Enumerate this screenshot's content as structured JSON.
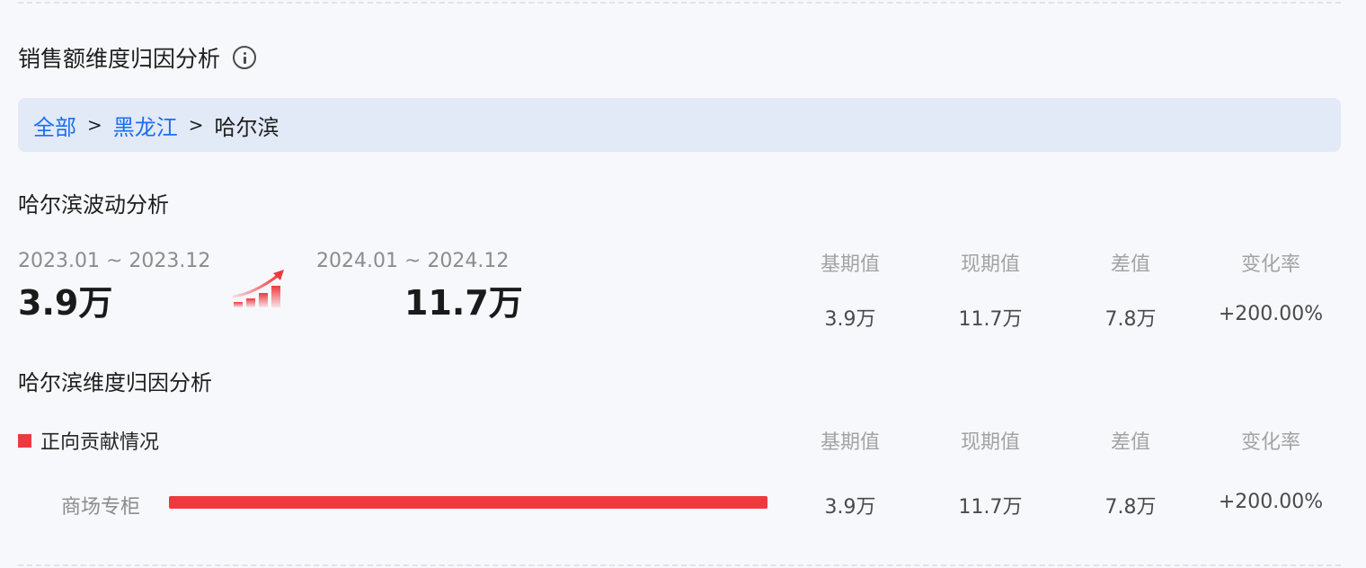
{
  "title": "销售额维度归因分析",
  "breadcrumb": {
    "items": [
      "全部",
      "黑龙江"
    ],
    "current": "哈尔滨",
    "separator": ">"
  },
  "fluctuation": {
    "title": "哈尔滨波动分析",
    "base_period": "2023.01 ~ 2023.12",
    "base_value": "3.9万",
    "current_period": "2024.01 ~ 2024.12",
    "current_value": "11.7万",
    "columns": [
      "基期值",
      "现期值",
      "差值",
      "变化率"
    ],
    "values": [
      "3.9万",
      "11.7万",
      "7.8万",
      "+200.00%"
    ]
  },
  "attribution": {
    "title": "哈尔滨维度归因分析",
    "legend": "正向贡献情况",
    "columns": [
      "基期值",
      "现期值",
      "差值",
      "变化率"
    ],
    "rows": [
      {
        "label": "商场专柜",
        "share": 1.0,
        "values": [
          "3.9万",
          "11.7万",
          "7.8万",
          "+200.00%"
        ]
      }
    ]
  },
  "colors": {
    "accent_blue": "#1a6ff0",
    "positive_red": "#ee3a3e",
    "breadcrumb_bg": "#e2eaf8"
  },
  "icons": {
    "info": "info-icon",
    "trend": "trend-up-icon"
  }
}
